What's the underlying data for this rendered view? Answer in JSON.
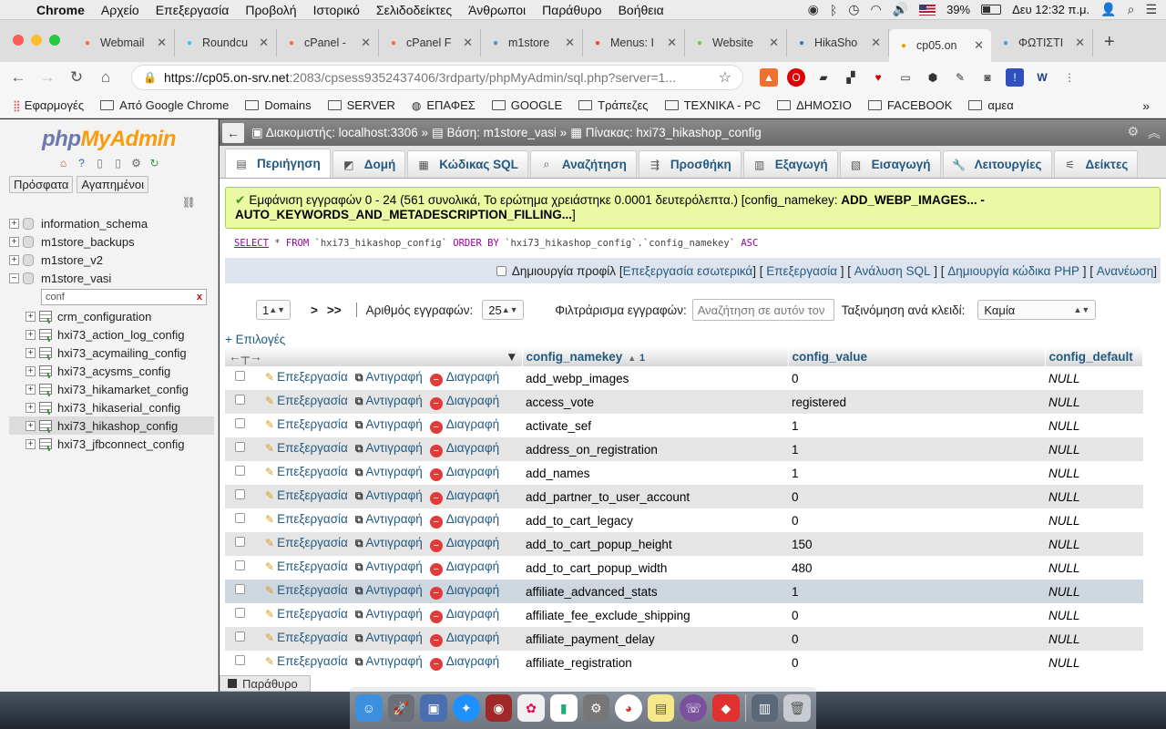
{
  "menubar": {
    "app": "Chrome",
    "items": [
      "Αρχείο",
      "Επεξεργασία",
      "Προβολή",
      "Ιστορικό",
      "Σελιδοδείκτες",
      "Άνθρωποι",
      "Παράθυρο",
      "Βοήθεια"
    ],
    "battery": "39%",
    "clock": "Δευ 12:32 π.μ."
  },
  "browser": {
    "tabs": [
      {
        "title": "Webmail",
        "icon": "cpanel-icon",
        "color": "#ff6c2c"
      },
      {
        "title": "Roundcu",
        "icon": "roundcube-icon",
        "color": "#37beff"
      },
      {
        "title": "cPanel -",
        "icon": "cpanel-icon",
        "color": "#ff6c2c"
      },
      {
        "title": "cPanel F",
        "icon": "cpanel-icon",
        "color": "#ff6c2c"
      },
      {
        "title": "m1store",
        "icon": "joomla-icon",
        "color": "#5091cd"
      },
      {
        "title": "Menus: I",
        "icon": "joomla-icon",
        "color": "#f44321"
      },
      {
        "title": "Website",
        "icon": "joomla-icon",
        "color": "#7ac143"
      },
      {
        "title": "HikaSho",
        "icon": "hikashop-icon",
        "color": "#2b7fbf"
      },
      {
        "title": "cp05.on",
        "icon": "phpmyadmin-icon",
        "color": "#f89c0e",
        "active": true
      },
      {
        "title": "ΦΩΤΙΣΤΙ",
        "icon": "site-icon",
        "color": "#3aa0e0"
      }
    ],
    "url_host": "https://cp05.on-srv.net",
    "url_rest": ":2083/cpsess9352437406/3rdparty/phpMyAdmin/sql.php?server=1...",
    "bookmarks": [
      {
        "label": "Εφαρμογές",
        "icon": "apps-grid-icon"
      },
      {
        "label": "Από Google Chrome",
        "icon": "folder-icon"
      },
      {
        "label": "Domains",
        "icon": "folder-icon"
      },
      {
        "label": "SERVER",
        "icon": "folder-icon"
      },
      {
        "label": "ΕΠΑΦΕΣ",
        "icon": "globe-icon"
      },
      {
        "label": "GOOGLE",
        "icon": "folder-icon"
      },
      {
        "label": "Τράπεζες",
        "icon": "folder-icon"
      },
      {
        "label": "ΤΕΧΝΙΚΑ - PC",
        "icon": "folder-icon"
      },
      {
        "label": "ΔΗΜΟΣΙΟ",
        "icon": "folder-icon"
      },
      {
        "label": "FACEBOOK",
        "icon": "folder-icon"
      },
      {
        "label": "αμεα",
        "icon": "folder-icon"
      }
    ],
    "bookmarks_more": "»"
  },
  "pma": {
    "logo_php": "php",
    "logo_ma": "MyAdmin",
    "nav_tabs": [
      "Πρόσφατα",
      "Αγαπημένοι"
    ],
    "databases_top": [
      "information_schema",
      "m1store_backups",
      "m1store_v2"
    ],
    "current_db": "m1store_vasi",
    "filter_value": "conf",
    "filter_clear": "x",
    "tables": [
      "crm_configuration",
      "hxi73_action_log_config",
      "hxi73_acymailing_config",
      "hxi73_acysms_config",
      "hxi73_hikamarket_config",
      "hxi73_hikaserial_config",
      "hxi73_hikashop_config",
      "hxi73_jfbconnect_config"
    ],
    "selected_table": "hxi73_hikashop_config",
    "breadcrumb": {
      "server": "Διακομιστής: localhost:3306",
      "db": "Βάση: m1store_vasi",
      "table": "Πίνακας: hxi73_hikashop_config"
    },
    "main_tabs": [
      {
        "label": "Περιήγηση",
        "icon": "browse-icon",
        "glyph": "▤"
      },
      {
        "label": "Δομή",
        "icon": "structure-icon",
        "glyph": "◩"
      },
      {
        "label": "Κώδικας SQL",
        "icon": "sql-icon",
        "glyph": "▦"
      },
      {
        "label": "Αναζήτηση",
        "icon": "search-icon",
        "glyph": "⌕"
      },
      {
        "label": "Προσθήκη",
        "icon": "insert-icon",
        "glyph": "⇶"
      },
      {
        "label": "Εξαγωγή",
        "icon": "export-icon",
        "glyph": "▥"
      },
      {
        "label": "Εισαγωγή",
        "icon": "import-icon",
        "glyph": "▧"
      },
      {
        "label": "Λειτουργίες",
        "icon": "operations-icon",
        "glyph": "🔧"
      },
      {
        "label": "Δείκτες",
        "icon": "triggers-icon",
        "glyph": "⚟"
      }
    ],
    "success_text": "Εμφάνιση εγγραφών 0 - 24 (561 συνολικά, Το ερώτημα χρειάστηκε 0.0001 δευτερόλεπτα.) [config_namekey: ",
    "success_bold": "ADD_WEBP_IMAGES... - AUTO_KEYWORDS_AND_METADESCRIPTION_FILLING...",
    "success_end": "]",
    "sql": {
      "select": "SELECT",
      "mid1": " * ",
      "from": "FROM",
      "table": " `hxi73_hikashop_config` ",
      "order": "ORDER BY",
      "col": " `hxi73_hikashop_config`.`config_namekey` ",
      "asc": "ASC"
    },
    "actions": {
      "profile": "Δημιουργία προφίλ",
      "edit_inline": "Επεξεργασία εσωτερικά",
      "edit": "Επεξεργασία",
      "explain": "Ανάλυση SQL",
      "php": "Δημιουργία κώδικα PHP",
      "refresh": "Ανανέωση"
    },
    "nav": {
      "page": "1",
      "next": ">",
      "last": ">>",
      "rows_label": "Αριθμός εγγραφών:",
      "rows_value": "25",
      "filter_label": "Φιλτράρισμα εγγραφών:",
      "filter_placeholder": "Αναζήτηση σε αυτόν τον",
      "sort_label": "Ταξινόμηση ανά κλειδί:",
      "sort_value": "Καμία"
    },
    "options_link": "+ Επιλογές",
    "columns": {
      "namekey": "config_namekey",
      "sort_num": "1",
      "value": "config_value",
      "default": "config_default"
    },
    "row_actions": {
      "edit": "Επεξεργασία",
      "copy": "Αντιγραφή",
      "delete": "Διαγραφή"
    },
    "rows": [
      {
        "key": "add_webp_images",
        "value": "0",
        "default": "NULL"
      },
      {
        "key": "access_vote",
        "value": "registered",
        "default": "NULL"
      },
      {
        "key": "activate_sef",
        "value": "1",
        "default": "NULL"
      },
      {
        "key": "address_on_registration",
        "value": "1",
        "default": "NULL"
      },
      {
        "key": "add_names",
        "value": "1",
        "default": "NULL"
      },
      {
        "key": "add_partner_to_user_account",
        "value": "0",
        "default": "NULL"
      },
      {
        "key": "add_to_cart_legacy",
        "value": "0",
        "default": "NULL"
      },
      {
        "key": "add_to_cart_popup_height",
        "value": "150",
        "default": "NULL"
      },
      {
        "key": "add_to_cart_popup_width",
        "value": "480",
        "default": "NULL"
      },
      {
        "key": "affiliate_advanced_stats",
        "value": "1",
        "default": "NULL",
        "highlight": true
      },
      {
        "key": "affiliate_fee_exclude_shipping",
        "value": "0",
        "default": "NULL"
      },
      {
        "key": "affiliate_payment_delay",
        "value": "0",
        "default": "NULL"
      },
      {
        "key": "affiliate_registration",
        "value": "0",
        "default": "NULL"
      }
    ],
    "console_label": "Παράθυρο"
  }
}
